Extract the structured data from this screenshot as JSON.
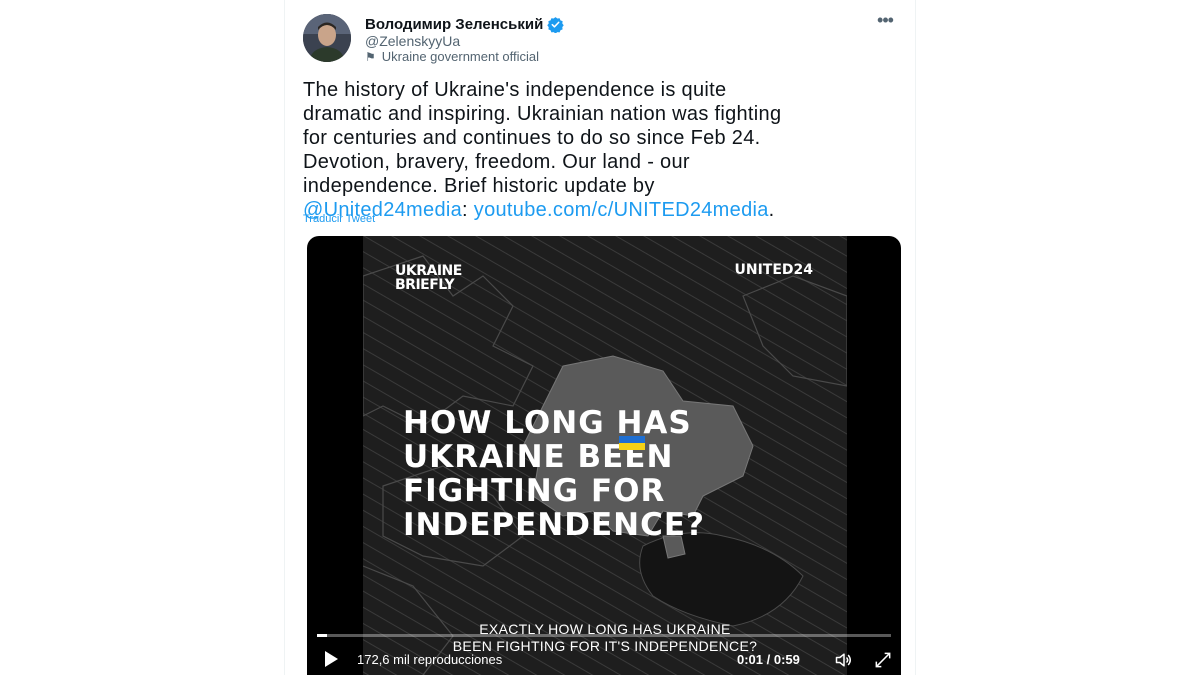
{
  "tweet": {
    "author": {
      "display_name": "Володимир Зеленський",
      "handle": "@ZelenskyyUa",
      "label": "Ukraine government official",
      "verified_icon": "verified-badge-icon",
      "label_icon": "flag-icon"
    },
    "more_icon": "more-options-icon",
    "text_lines": [
      "The history of Ukraine's independence is quite",
      "dramatic and inspiring. Ukrainian nation was fighting",
      "for centuries and continues to do so since Feb 24.",
      "Devotion, bravery, freedom. Our land - our",
      "independence. Brief historic update by"
    ],
    "mention": "@United24media",
    "separator": ":",
    "url_text": "youtube.com/c/UNITED24media",
    "end_punct": ".",
    "translate_label": "Traducir Tweet"
  },
  "video": {
    "brand_left_line1": "UKRAINE",
    "brand_left_line2": "BRIEFLY",
    "brand_right": "UNITED24",
    "headline_lines": [
      "HOW LONG HAS",
      "UKRAINE BEEN",
      "FIGHTING FOR",
      "INDEPENDENCE?"
    ],
    "subtitle_line1": "EXACTLY HOW LONG HAS UKRAINE",
    "subtitle_line2": "BEEN FIGHTING FOR IT'S INDEPENDENCE?",
    "views": "172,6 mil reproducciones",
    "time": "0:01 / 0:59",
    "progress": 0.017,
    "flag_colors": {
      "blue": "#1f6fd1",
      "yellow": "#f5d215"
    }
  },
  "colors": {
    "accent": "#1d9bf0",
    "text_primary": "#0f1419",
    "text_secondary": "#536471"
  }
}
